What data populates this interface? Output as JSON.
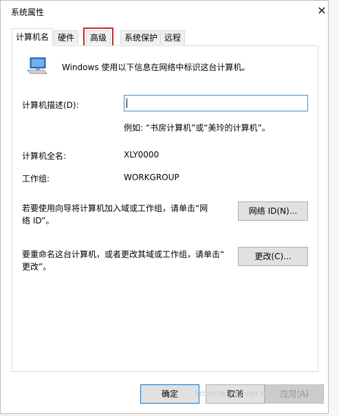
{
  "window": {
    "title": "系统属性",
    "close_glyph": "✕"
  },
  "tabs": [
    {
      "label": "计算机名",
      "active": true
    },
    {
      "label": "硬件"
    },
    {
      "label": "高级",
      "highlighted": true
    },
    {
      "label": "系统保护"
    },
    {
      "label": "远程"
    }
  ],
  "panel": {
    "info_text": "Windows 使用以下信息在网络中标识这台计算机。",
    "description_label": "计算机描述(D):",
    "description_value": "",
    "example_text": "例如: “书房计算机”或“美玲的计算机”。",
    "full_name_label": "计算机全名:",
    "full_name_value": "XLY0000",
    "workgroup_label": "工作组:",
    "workgroup_value": "WORKGROUP",
    "domain_text_line1": "若要使用向导将计算机加入域或工作组，请单击“网",
    "domain_text_line2": "络 ID”。",
    "network_id_button": "网络 ID(N)...",
    "rename_text_line1": "要重命名这台计算机，或者更改其域或工作组，请单击“",
    "rename_text_line2": "更改”。",
    "change_button": "更改(C)..."
  },
  "buttons": {
    "ok": "确定",
    "cancel": "取消",
    "apply": "应用(A)"
  },
  "watermark": "https://blog.csdn.net/jiandanyou",
  "colors": {
    "accent": "#0078d7",
    "highlight_box": "#c62828",
    "input_border": "#3b8fe0"
  }
}
